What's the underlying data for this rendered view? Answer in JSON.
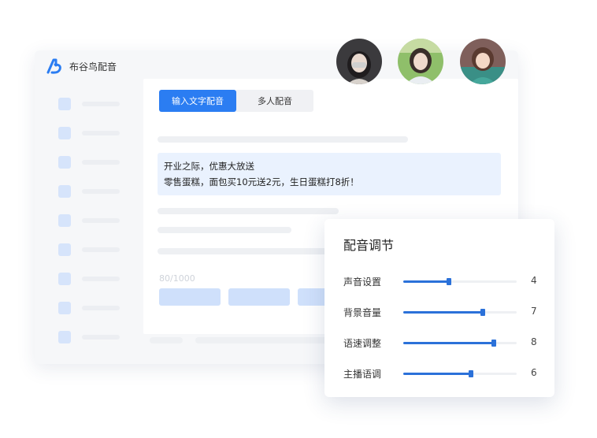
{
  "app": {
    "name": "布谷鸟配音",
    "logo_icon": "logo-icon"
  },
  "colors": {
    "accent": "#2b7df2",
    "text_highlight": "#eaf2fe"
  },
  "tabs": [
    {
      "label": "输入文字配音",
      "active": true
    },
    {
      "label": "多人配音",
      "active": false
    }
  ],
  "editor": {
    "lines": [
      "开业之际，优惠大放送",
      "零售蛋糕，面包买10元送2元，生日蛋糕打8折！"
    ],
    "char_count": "80/1000"
  },
  "avatars": [
    "avatar-voice-1",
    "avatar-voice-2",
    "avatar-voice-3"
  ],
  "adjust": {
    "title": "配音调节",
    "max": 10,
    "rows": [
      {
        "label": "声音设置",
        "value": 4
      },
      {
        "label": "背景音量",
        "value": 7
      },
      {
        "label": "语速调整",
        "value": 8
      },
      {
        "label": "主播语调",
        "value": 6
      }
    ]
  }
}
